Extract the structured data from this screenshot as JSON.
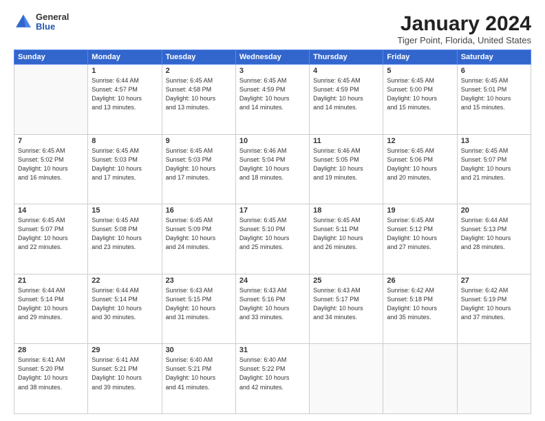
{
  "header": {
    "logo_general": "General",
    "logo_blue": "Blue",
    "title": "January 2024",
    "subtitle": "Tiger Point, Florida, United States"
  },
  "days_of_week": [
    "Sunday",
    "Monday",
    "Tuesday",
    "Wednesday",
    "Thursday",
    "Friday",
    "Saturday"
  ],
  "weeks": [
    [
      {
        "day": "",
        "info": ""
      },
      {
        "day": "1",
        "info": "Sunrise: 6:44 AM\nSunset: 4:57 PM\nDaylight: 10 hours\nand 13 minutes."
      },
      {
        "day": "2",
        "info": "Sunrise: 6:45 AM\nSunset: 4:58 PM\nDaylight: 10 hours\nand 13 minutes."
      },
      {
        "day": "3",
        "info": "Sunrise: 6:45 AM\nSunset: 4:59 PM\nDaylight: 10 hours\nand 14 minutes."
      },
      {
        "day": "4",
        "info": "Sunrise: 6:45 AM\nSunset: 4:59 PM\nDaylight: 10 hours\nand 14 minutes."
      },
      {
        "day": "5",
        "info": "Sunrise: 6:45 AM\nSunset: 5:00 PM\nDaylight: 10 hours\nand 15 minutes."
      },
      {
        "day": "6",
        "info": "Sunrise: 6:45 AM\nSunset: 5:01 PM\nDaylight: 10 hours\nand 15 minutes."
      }
    ],
    [
      {
        "day": "7",
        "info": "Sunrise: 6:45 AM\nSunset: 5:02 PM\nDaylight: 10 hours\nand 16 minutes."
      },
      {
        "day": "8",
        "info": "Sunrise: 6:45 AM\nSunset: 5:03 PM\nDaylight: 10 hours\nand 17 minutes."
      },
      {
        "day": "9",
        "info": "Sunrise: 6:45 AM\nSunset: 5:03 PM\nDaylight: 10 hours\nand 17 minutes."
      },
      {
        "day": "10",
        "info": "Sunrise: 6:46 AM\nSunset: 5:04 PM\nDaylight: 10 hours\nand 18 minutes."
      },
      {
        "day": "11",
        "info": "Sunrise: 6:46 AM\nSunset: 5:05 PM\nDaylight: 10 hours\nand 19 minutes."
      },
      {
        "day": "12",
        "info": "Sunrise: 6:45 AM\nSunset: 5:06 PM\nDaylight: 10 hours\nand 20 minutes."
      },
      {
        "day": "13",
        "info": "Sunrise: 6:45 AM\nSunset: 5:07 PM\nDaylight: 10 hours\nand 21 minutes."
      }
    ],
    [
      {
        "day": "14",
        "info": "Sunrise: 6:45 AM\nSunset: 5:07 PM\nDaylight: 10 hours\nand 22 minutes."
      },
      {
        "day": "15",
        "info": "Sunrise: 6:45 AM\nSunset: 5:08 PM\nDaylight: 10 hours\nand 23 minutes."
      },
      {
        "day": "16",
        "info": "Sunrise: 6:45 AM\nSunset: 5:09 PM\nDaylight: 10 hours\nand 24 minutes."
      },
      {
        "day": "17",
        "info": "Sunrise: 6:45 AM\nSunset: 5:10 PM\nDaylight: 10 hours\nand 25 minutes."
      },
      {
        "day": "18",
        "info": "Sunrise: 6:45 AM\nSunset: 5:11 PM\nDaylight: 10 hours\nand 26 minutes."
      },
      {
        "day": "19",
        "info": "Sunrise: 6:45 AM\nSunset: 5:12 PM\nDaylight: 10 hours\nand 27 minutes."
      },
      {
        "day": "20",
        "info": "Sunrise: 6:44 AM\nSunset: 5:13 PM\nDaylight: 10 hours\nand 28 minutes."
      }
    ],
    [
      {
        "day": "21",
        "info": "Sunrise: 6:44 AM\nSunset: 5:14 PM\nDaylight: 10 hours\nand 29 minutes."
      },
      {
        "day": "22",
        "info": "Sunrise: 6:44 AM\nSunset: 5:14 PM\nDaylight: 10 hours\nand 30 minutes."
      },
      {
        "day": "23",
        "info": "Sunrise: 6:43 AM\nSunset: 5:15 PM\nDaylight: 10 hours\nand 31 minutes."
      },
      {
        "day": "24",
        "info": "Sunrise: 6:43 AM\nSunset: 5:16 PM\nDaylight: 10 hours\nand 33 minutes."
      },
      {
        "day": "25",
        "info": "Sunrise: 6:43 AM\nSunset: 5:17 PM\nDaylight: 10 hours\nand 34 minutes."
      },
      {
        "day": "26",
        "info": "Sunrise: 6:42 AM\nSunset: 5:18 PM\nDaylight: 10 hours\nand 35 minutes."
      },
      {
        "day": "27",
        "info": "Sunrise: 6:42 AM\nSunset: 5:19 PM\nDaylight: 10 hours\nand 37 minutes."
      }
    ],
    [
      {
        "day": "28",
        "info": "Sunrise: 6:41 AM\nSunset: 5:20 PM\nDaylight: 10 hours\nand 38 minutes."
      },
      {
        "day": "29",
        "info": "Sunrise: 6:41 AM\nSunset: 5:21 PM\nDaylight: 10 hours\nand 39 minutes."
      },
      {
        "day": "30",
        "info": "Sunrise: 6:40 AM\nSunset: 5:21 PM\nDaylight: 10 hours\nand 41 minutes."
      },
      {
        "day": "31",
        "info": "Sunrise: 6:40 AM\nSunset: 5:22 PM\nDaylight: 10 hours\nand 42 minutes."
      },
      {
        "day": "",
        "info": ""
      },
      {
        "day": "",
        "info": ""
      },
      {
        "day": "",
        "info": ""
      }
    ]
  ]
}
